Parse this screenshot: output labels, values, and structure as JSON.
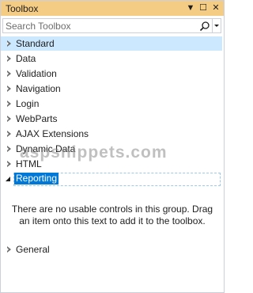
{
  "window": {
    "title": "Toolbox",
    "title_bar_color": "#f5cc84"
  },
  "controls": {
    "dropdown_glyph": "▼",
    "maximize_glyph": "☐",
    "close_glyph": "✕"
  },
  "search": {
    "placeholder": "Search Toolbox",
    "value": ""
  },
  "groups": [
    {
      "label": "Standard",
      "expanded": false,
      "selected": true
    },
    {
      "label": "Data",
      "expanded": false
    },
    {
      "label": "Validation",
      "expanded": false
    },
    {
      "label": "Navigation",
      "expanded": false
    },
    {
      "label": "Login",
      "expanded": false
    },
    {
      "label": "WebParts",
      "expanded": false
    },
    {
      "label": "AJAX Extensions",
      "expanded": false
    },
    {
      "label": "Dynamic Data",
      "expanded": false
    },
    {
      "label": "HTML",
      "expanded": false
    },
    {
      "label": "Reporting",
      "expanded": true,
      "editing": true
    },
    {
      "label": "General",
      "expanded": false
    }
  ],
  "reporting_empty_message": "There are no usable controls in this group. Drag an item onto this text to add it to the toolbox.",
  "watermark": "aspsnippets.com",
  "colors": {
    "selection_highlight": "#cce8ff",
    "edit_highlight": "#0078d7",
    "border": "#cccedb"
  }
}
